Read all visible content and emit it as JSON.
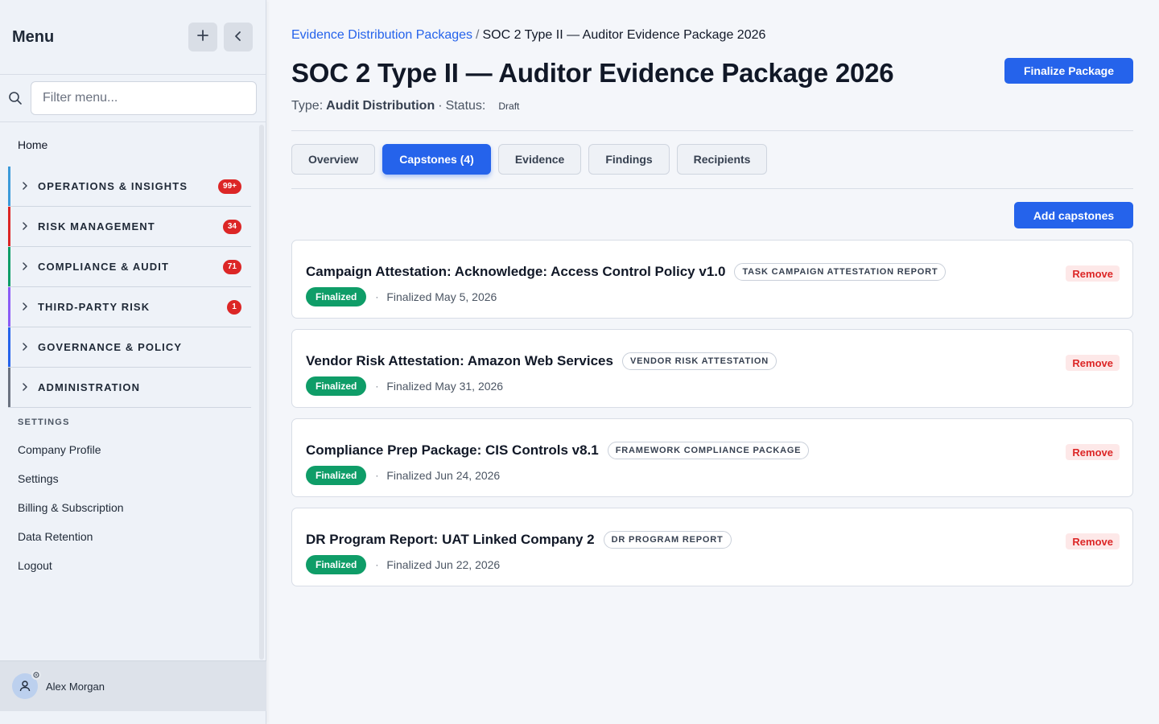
{
  "sidebar": {
    "title": "Menu",
    "add_icon": "plus-icon",
    "collapse_icon": "chevron-left-icon",
    "filter_placeholder": "Filter menu...",
    "home_label": "Home",
    "sections": [
      {
        "label": "OPERATIONS & INSIGHTS",
        "badge": "99+",
        "color": "#3b9ad9"
      },
      {
        "label": "RISK MANAGEMENT",
        "badge": "34",
        "color": "#dc2626"
      },
      {
        "label": "COMPLIANCE & AUDIT",
        "badge": "71",
        "color": "#0f9d68"
      },
      {
        "label": "THIRD-PARTY RISK",
        "badge": "1",
        "color": "#8b5cf6"
      },
      {
        "label": "GOVERNANCE & POLICY",
        "badge": "",
        "color": "#2563eb"
      },
      {
        "label": "ADMINISTRATION",
        "badge": "",
        "color": "#6b7280"
      }
    ],
    "settings_heading": "SETTINGS",
    "settings_links": [
      "Company Profile",
      "Settings",
      "Billing & Subscription",
      "Data Retention",
      "Logout"
    ],
    "user_name": "Alex Morgan"
  },
  "main": {
    "breadcrumb_link": "Evidence Distribution Packages",
    "breadcrumb_sep": "/",
    "breadcrumb_current": "SOC 2 Type II — Auditor Evidence Package 2026",
    "title": "SOC 2 Type II — Auditor Evidence Package 2026",
    "type_label": "Type:",
    "type_value": "Audit Distribution",
    "status_label": "Status:",
    "status_value": "Draft",
    "finalize_label": "Finalize Package",
    "tabs": [
      {
        "label": "Overview",
        "active": false
      },
      {
        "label": "Capstones (4)",
        "active": true
      },
      {
        "label": "Evidence",
        "active": false
      },
      {
        "label": "Findings",
        "active": false
      },
      {
        "label": "Recipients",
        "active": false
      }
    ],
    "add_label": "Add capstones",
    "remove_label": "Remove",
    "capstones": [
      {
        "title": "Campaign Attestation: Acknowledge: Access Control Policy v1.0",
        "type": "TASK CAMPAIGN ATTESTATION REPORT",
        "status": "Finalized",
        "date": "Finalized May 5, 2026"
      },
      {
        "title": "Vendor Risk Attestation: Amazon Web Services",
        "type": "VENDOR RISK ATTESTATION",
        "status": "Finalized",
        "date": "Finalized May 31, 2026"
      },
      {
        "title": "Compliance Prep Package: CIS Controls v8.1",
        "type": "FRAMEWORK COMPLIANCE PACKAGE",
        "status": "Finalized",
        "date": "Finalized Jun 24, 2026"
      },
      {
        "title": "DR Program Report: UAT Linked Company 2",
        "type": "DR PROGRAM REPORT",
        "status": "Finalized",
        "date": "Finalized Jun 22, 2026"
      }
    ]
  }
}
